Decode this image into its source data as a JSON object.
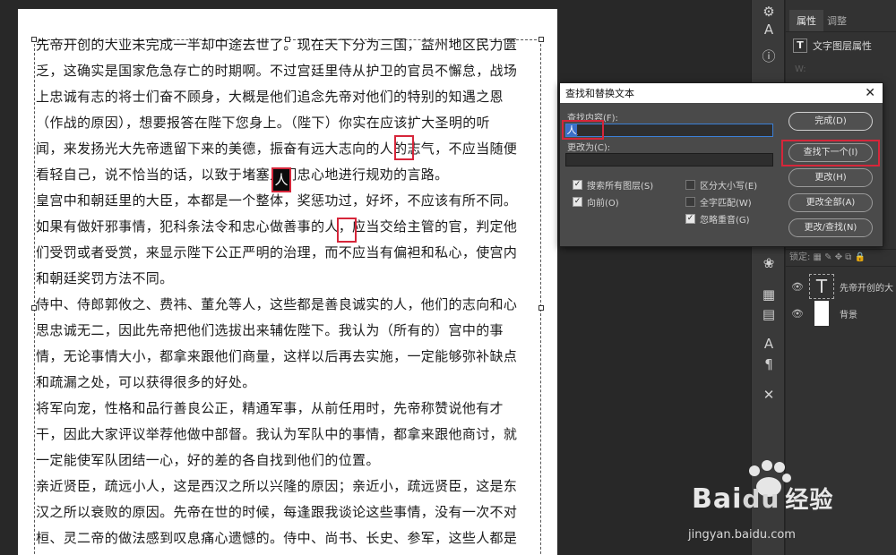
{
  "document": {
    "lines": [
      "先帝开创的大业未完成一半却中途去世了。现在天下分为三国，益州地区民力匮",
      "乏，这确实是国家危急存亡的时期啊。不过宫廷里侍从护卫的官员不懈怠，战场",
      "上忠诚有志的将士们奋不顾身，大概是他们追念先帝对他们的特别的知遇之恩",
      "（作战的原因），想要报答在陛下您身上。（陛下）你实在应该扩大圣明的听",
      "闻，来发扬光大先帝遗留下来的美德，振奋有远大志向的人的志气，不应当随便",
      "看轻自己，说不恰当的话，以致于堵塞人们忠心地进行规劝的言路。",
      "皇宫中和朝廷里的大臣，本都是一个整体，奖惩功过，好坏，不应该有所不同。",
      "如果有做奸邪事情，犯科条法令和忠心做善事的人，应当交给主管的官，判定他",
      "们受罚或者受赏，来显示陛下公正严明的治理，而不应当有偏袒和私心，使宫内",
      "和朝廷奖罚方法不同。",
      "侍中、侍郎郭攸之、费祎、董允等人，这些都是善良诚实的人，他们的志向和心",
      "思忠诚无二，因此先帝把他们选拔出来辅佐陛下。我认为（所有的）宫中的事",
      "情，无论事情大小，都拿来跟他们商量，这样以后再去实施，一定能够弥补缺点",
      "和疏漏之处，可以获得很多的好处。",
      "将军向宠，性格和品行善良公正，精通军事，从前任用时，先帝称赞说他有才",
      "干，因此大家评议举荐他做中部督。我认为军队中的事情，都拿来跟他商讨，就",
      "一定能使军队团结一心，好的差的各自找到他们的位置。",
      "亲近贤臣，疏远小人，这是西汉之所以兴隆的原因；亲近小，疏远贤臣，这是东",
      "汉之所以衰败的原因。先帝在世的时候，每逢跟我谈论这些事情，没有一次不对",
      "桓、灵二帝的做法感到叹息痛心遗憾的。侍中、尚书、长史、参军，这些人都是"
    ],
    "highlight_char": "人"
  },
  "props_panel": {
    "tabs": [
      "属性",
      "调整"
    ],
    "title": "文字图层属性",
    "layers": [
      {
        "name": "先帝开创的大",
        "type_icon": "T"
      },
      {
        "name": "背景",
        "type_icon": ""
      }
    ]
  },
  "dialog": {
    "title": "查找和替换文本",
    "find_label": "查找内容(F):",
    "find_value": "人",
    "replace_label": "更改为(C):",
    "replace_value": "",
    "options": [
      {
        "label": "搜索所有图层(S)",
        "checked": true
      },
      {
        "label": "向前(O)",
        "checked": true
      },
      {
        "label": "区分大小写(E)",
        "checked": false
      },
      {
        "label": "全字匹配(W)",
        "checked": false
      },
      {
        "label": "忽略重音(G)",
        "checked": true
      }
    ],
    "buttons": {
      "done": "完成(D)",
      "find_next": "查找下一个(I)",
      "change": "更改(H)",
      "change_all": "更改全部(A)",
      "change_find": "更改/查找(N)"
    }
  },
  "watermark": {
    "brand": "Bai",
    "brand_cn": "经验",
    "url": "jingyan.baidu.com"
  },
  "colors": {
    "accent_red": "#d6263a",
    "panel_bg": "#323232",
    "dialog_bg": "#4a4a4a"
  }
}
